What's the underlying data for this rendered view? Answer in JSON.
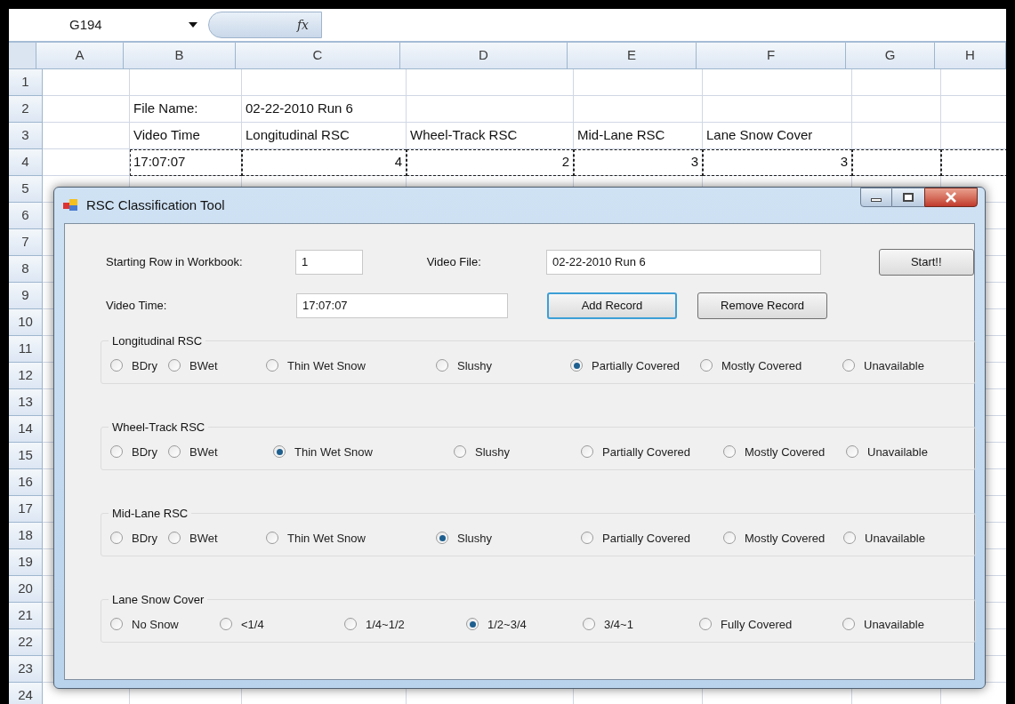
{
  "name_box": "G194",
  "formula_button": "fx",
  "columns": [
    "A",
    "B",
    "C",
    "D",
    "E",
    "F",
    "G",
    "H"
  ],
  "rows": [
    {
      "number": "1",
      "marquee": false
    },
    {
      "number": "2",
      "marquee": false,
      "cells": {
        "B": {
          "text": "File Name:",
          "kind": "text"
        },
        "C": {
          "text": "02-22-2010 Run 6",
          "kind": "text"
        }
      }
    },
    {
      "number": "3",
      "marquee": false,
      "cells": {
        "B": {
          "text": "Video Time",
          "kind": "text"
        },
        "C": {
          "text": "Longitudinal RSC",
          "kind": "text"
        },
        "D": {
          "text": "Wheel-Track RSC",
          "kind": "text"
        },
        "E": {
          "text": "Mid-Lane RSC",
          "kind": "text"
        },
        "F": {
          "text": "Lane Snow Cover",
          "kind": "text"
        }
      }
    },
    {
      "number": "4",
      "marquee": true,
      "cells": {
        "B": {
          "text": "17:07:07",
          "kind": "text"
        },
        "C": {
          "text": "4",
          "kind": "number"
        },
        "D": {
          "text": "2",
          "kind": "number"
        },
        "E": {
          "text": "3",
          "kind": "number"
        },
        "F": {
          "text": "3",
          "kind": "number"
        }
      }
    },
    {
      "number": "5",
      "marquee": false
    },
    {
      "number": "6",
      "marquee": false
    },
    {
      "number": "7",
      "marquee": false
    },
    {
      "number": "8",
      "marquee": false
    },
    {
      "number": "9",
      "marquee": false
    },
    {
      "number": "10",
      "marquee": false
    },
    {
      "number": "11",
      "marquee": false
    },
    {
      "number": "12",
      "marquee": false
    },
    {
      "number": "13",
      "marquee": false
    },
    {
      "number": "14",
      "marquee": false
    },
    {
      "number": "15",
      "marquee": false
    },
    {
      "number": "16",
      "marquee": false
    },
    {
      "number": "17",
      "marquee": false
    },
    {
      "number": "18",
      "marquee": false
    },
    {
      "number": "19",
      "marquee": false
    },
    {
      "number": "20",
      "marquee": false
    },
    {
      "number": "21",
      "marquee": false
    },
    {
      "number": "22",
      "marquee": false
    },
    {
      "number": "23",
      "marquee": false
    },
    {
      "number": "24",
      "marquee": false
    }
  ],
  "dialog": {
    "title": "RSC Classification Tool",
    "starting_row": {
      "label": "Starting Row in Workbook:",
      "value": "1"
    },
    "video_file": {
      "label": "Video File:",
      "value": "02-22-2010 Run 6"
    },
    "video_time": {
      "label": "Video Time:",
      "value": "17:07:07"
    },
    "start_button": {
      "label": "Start!!",
      "focused": false
    },
    "add_button": {
      "label": "Add Record",
      "focused": true
    },
    "remove_button": {
      "label": "Remove Record",
      "focused": false
    },
    "groups": [
      {
        "title": "Longitudinal RSC",
        "options": [
          {
            "label": "BDry",
            "selected": false
          },
          {
            "label": "BWet",
            "selected": false
          },
          {
            "label": "Thin Wet Snow",
            "selected": false
          },
          {
            "label": "Slushy",
            "selected": false
          },
          {
            "label": "Partially Covered",
            "selected": true
          },
          {
            "label": "Mostly Covered",
            "selected": false
          },
          {
            "label": "Unavailable",
            "selected": false
          }
        ]
      },
      {
        "title": "Wheel-Track RSC",
        "options": [
          {
            "label": "BDry",
            "selected": false
          },
          {
            "label": "BWet",
            "selected": false
          },
          {
            "label": "Thin Wet Snow",
            "selected": true
          },
          {
            "label": "Slushy",
            "selected": false
          },
          {
            "label": "Partially Covered",
            "selected": false
          },
          {
            "label": "Mostly Covered",
            "selected": false
          },
          {
            "label": "Unavailable",
            "selected": false
          }
        ]
      },
      {
        "title": "Mid-Lane RSC",
        "options": [
          {
            "label": "BDry",
            "selected": false
          },
          {
            "label": "BWet",
            "selected": false
          },
          {
            "label": "Thin Wet Snow",
            "selected": false
          },
          {
            "label": "Slushy",
            "selected": true
          },
          {
            "label": "Partially Covered",
            "selected": false
          },
          {
            "label": "Mostly Covered",
            "selected": false
          },
          {
            "label": "Unavailable",
            "selected": false
          }
        ]
      },
      {
        "title": "Lane Snow Cover",
        "options": [
          {
            "label": "No Snow",
            "selected": false
          },
          {
            "label": "<1/4",
            "selected": false
          },
          {
            "label": "1/4~1/2",
            "selected": false
          },
          {
            "label": "1/2~3/4",
            "selected": true
          },
          {
            "label": "3/4~1",
            "selected": false
          },
          {
            "label": "Fully Covered",
            "selected": false
          },
          {
            "label": "Unavailable",
            "selected": false
          }
        ]
      }
    ]
  }
}
